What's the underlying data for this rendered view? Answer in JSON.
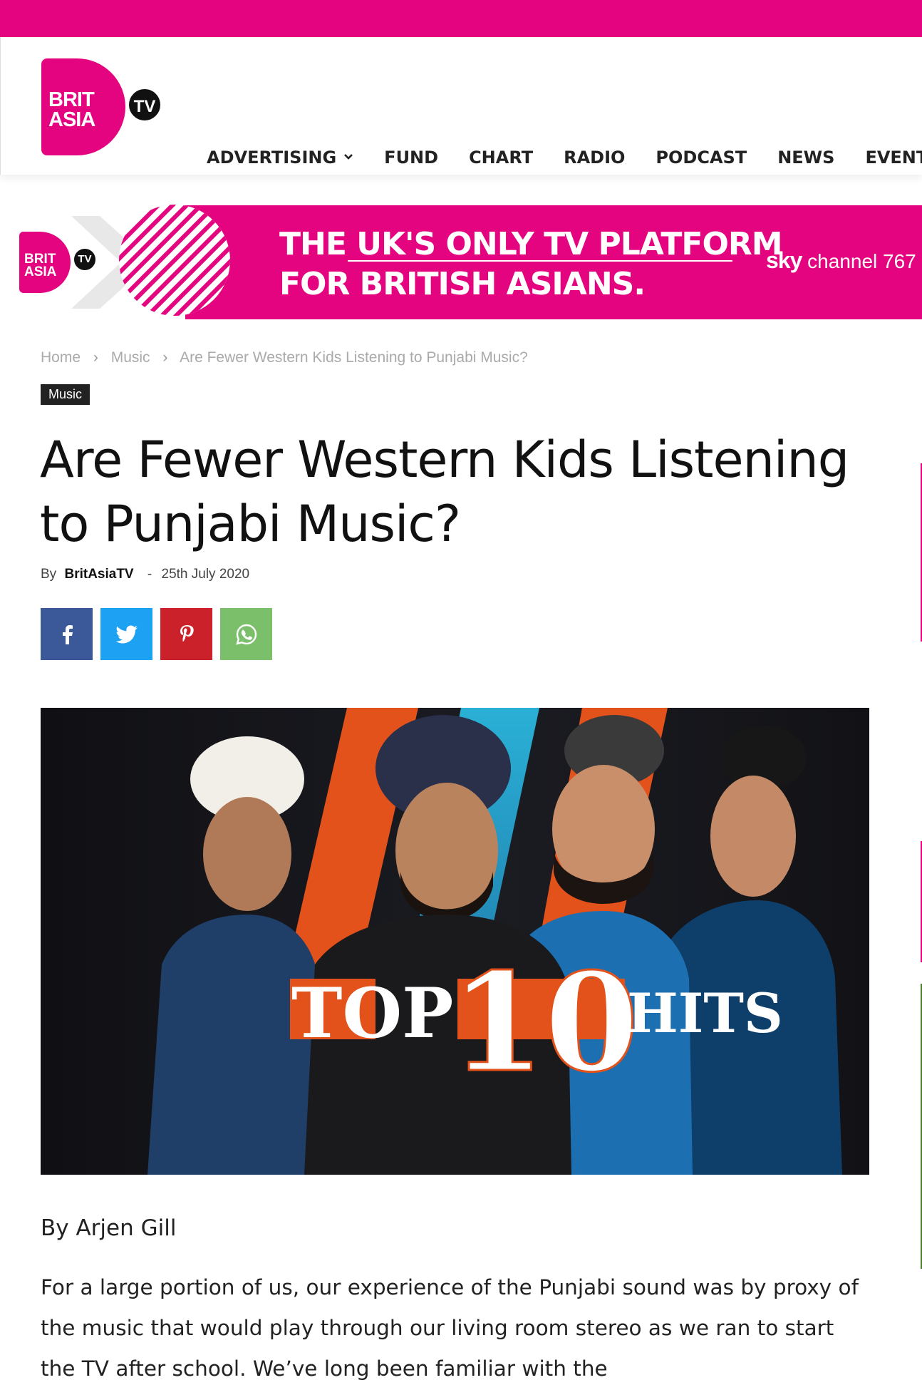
{
  "brand": {
    "logo_line1": "BRIT",
    "logo_line2": "ASIA",
    "logo_badge": "TV",
    "color": "#e5047f"
  },
  "nav": {
    "items": [
      {
        "label": "ADVERTISING",
        "has_dropdown": true
      },
      {
        "label": "FUND"
      },
      {
        "label": "CHART"
      },
      {
        "label": "RADIO"
      },
      {
        "label": "PODCAST"
      },
      {
        "label": "NEWS"
      },
      {
        "label": "EVENTS"
      }
    ]
  },
  "banner": {
    "logo_line1": "BRIT",
    "logo_line2": "ASIA",
    "logo_badge": "TV",
    "headline_line1": "THE UK'S ONLY TV PLATFORM",
    "headline_line2": "FOR BRITISH ASIANS.",
    "sky_brand": "sky",
    "sky_channel": "channel 767"
  },
  "breadcrumb": {
    "items": [
      "Home",
      "Music",
      "Are Fewer Western Kids Listening to Punjabi Music?"
    ],
    "separator": "›"
  },
  "article": {
    "category": "Music",
    "title": "Are Fewer Western Kids Listening to Punjabi Music?",
    "by_label": "By",
    "author": "BritAsiaTV",
    "date_separator": "-",
    "date": "25th July 2020",
    "share": [
      {
        "network": "facebook",
        "icon": "facebook-icon",
        "color": "#3b5998"
      },
      {
        "network": "twitter",
        "icon": "twitter-icon",
        "color": "#1da1f2"
      },
      {
        "network": "pinterest",
        "icon": "pinterest-icon",
        "color": "#ca212a"
      },
      {
        "network": "whatsapp",
        "icon": "whatsapp-icon",
        "color": "#7bbf6a"
      }
    ],
    "hero_text_top": "TOP",
    "hero_text_number": "10",
    "hero_text_hits": "HITS",
    "byline": "By Arjen Gill",
    "body": "For a large portion of us, our experience of the Punjabi sound was by proxy of the music that would play through our living room stereo as we ran to start the TV after school. We’ve long been familiar with the"
  }
}
